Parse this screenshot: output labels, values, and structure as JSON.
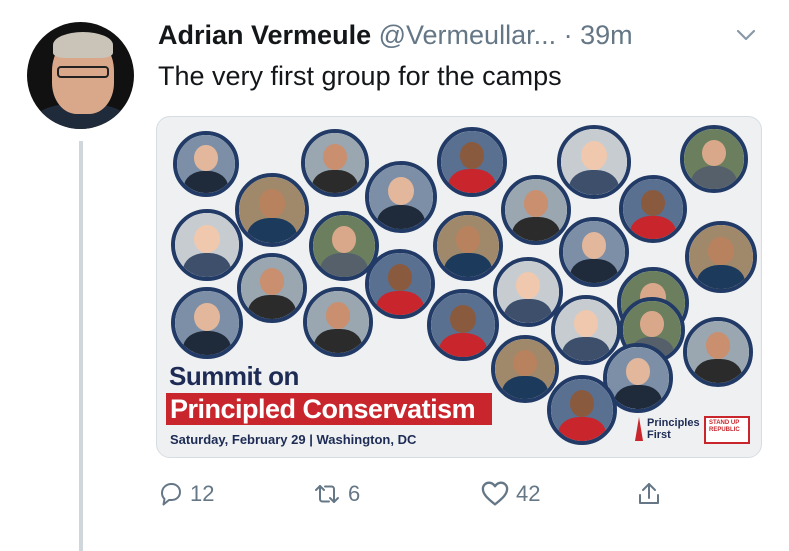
{
  "tweet": {
    "display_name": "Adrian Vermeule",
    "handle": "@Vermeullar...",
    "time": "· 39m",
    "text": "The very first group for the camps"
  },
  "card": {
    "title_line1": "Summit on",
    "title_line2": "Principled Conservatism",
    "subtitle": "Saturday, February 29 | Washington, DC",
    "logo_principles": "Principles First",
    "logo_standup": "STAND UP REPUBLIC",
    "accent_color": "#c8262c",
    "navy_color": "#1d2b55"
  },
  "actions": {
    "reply_count": "12",
    "retweet_count": "6",
    "like_count": "42"
  },
  "icons": {
    "reply": "reply-icon",
    "retweet": "retweet-icon",
    "like": "heart-icon",
    "share": "share-icon",
    "caret": "chevron-down-icon"
  }
}
